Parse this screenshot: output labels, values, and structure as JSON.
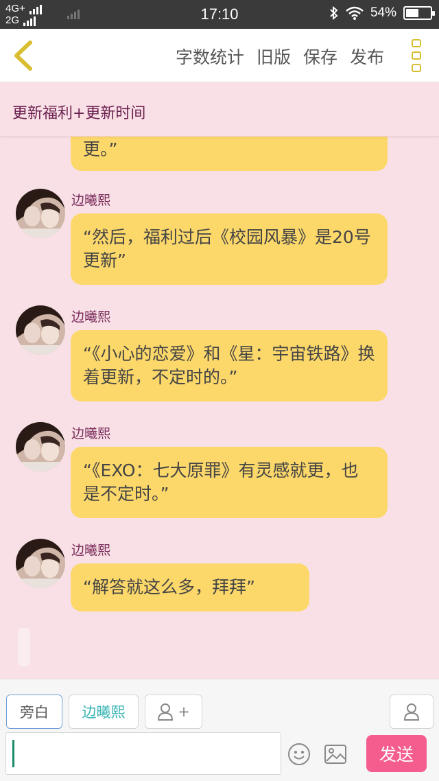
{
  "status_bar": {
    "network_top": "4G+",
    "network_bottom": "2G",
    "time": "17:10",
    "battery": "54%",
    "battery_level": 0.54
  },
  "toolbar": {
    "back_icon": "chevron-left-icon",
    "actions": [
      "字数统计",
      "旧版",
      "保存",
      "发布"
    ],
    "menu_icon": "more-icon",
    "accent": "#d9be32"
  },
  "story": {
    "title": "更新福利+更新时间"
  },
  "messages": {
    "partial_tail": "更。”",
    "list": [
      {
        "sender": "边曦熙",
        "text": "“然后，福利过后《校园风暴》是20号更新”"
      },
      {
        "sender": "边曦熙",
        "text": "“《小心的恋爱》和《星：宇宙铁路》换着更新，不定时的。”"
      },
      {
        "sender": "边曦熙",
        "text": "“《EXO：七大原罪》有灵感就更，也是不定时。”"
      },
      {
        "sender": "边曦熙",
        "text": "“解答就这么多，拜拜”"
      }
    ],
    "bubble_color": "#fcd86b"
  },
  "composer": {
    "roles": {
      "narrator": "旁白",
      "character": "边曦熙",
      "add_plus": "+"
    },
    "input_value": "",
    "send": "发送",
    "send_color": "#f55d8f"
  }
}
